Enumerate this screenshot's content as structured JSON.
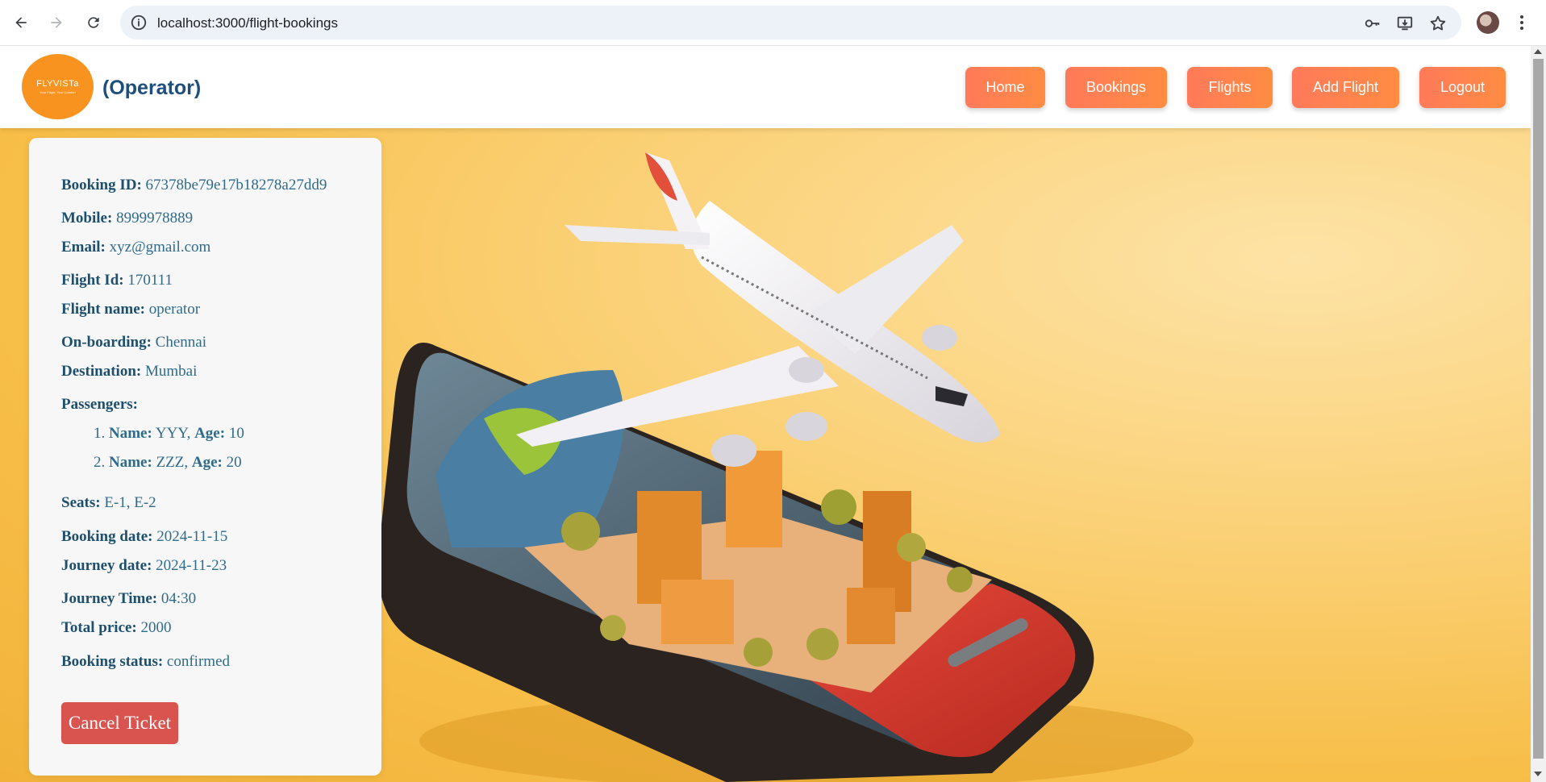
{
  "browser": {
    "url": "localhost:3000/flight-bookings"
  },
  "header": {
    "logo_text": "FLYVISTa",
    "logo_tagline": "Your Flight, Your Comfort",
    "role": "(Operator)",
    "nav": {
      "home": "Home",
      "bookings": "Bookings",
      "flights": "Flights",
      "add_flight": "Add Flight",
      "logout": "Logout"
    }
  },
  "booking": {
    "booking_id_label": "Booking ID:",
    "booking_id": "67378be79e17b18278a27dd9",
    "mobile_label": "Mobile:",
    "mobile": "8999978889",
    "email_label": "Email:",
    "email": "xyz@gmail.com",
    "flight_id_label": "Flight Id:",
    "flight_id": "170111",
    "flight_name_label": "Flight name:",
    "flight_name": "operator",
    "onboarding_label": "On-boarding:",
    "onboarding": "Chennai",
    "destination_label": "Destination:",
    "destination": "Mumbai",
    "passengers_label": "Passengers:",
    "passengers": [
      {
        "num": "1.",
        "name_label": "Name:",
        "name": "YYY,",
        "age_label": "Age:",
        "age": "10"
      },
      {
        "num": "2.",
        "name_label": "Name:",
        "name": "ZZZ,",
        "age_label": "Age:",
        "age": "20"
      }
    ],
    "seats_label": "Seats:",
    "seats": "E-1, E-2",
    "booking_date_label": "Booking date:",
    "booking_date": "2024-11-15",
    "journey_date_label": "Journey date:",
    "journey_date": "2024-11-23",
    "journey_time_label": "Journey Time:",
    "journey_time": "04:30",
    "total_price_label": "Total price:",
    "total_price": "2000",
    "status_label": "Booking status:",
    "status": "confirmed",
    "cancel_label": "Cancel Ticket"
  },
  "colors": {
    "accent_start": "#ff7a5a",
    "accent_end": "#ff8c42",
    "cancel": "#d9534f",
    "role_text": "#1d4f7c",
    "logo_bg": "#f7931e"
  }
}
